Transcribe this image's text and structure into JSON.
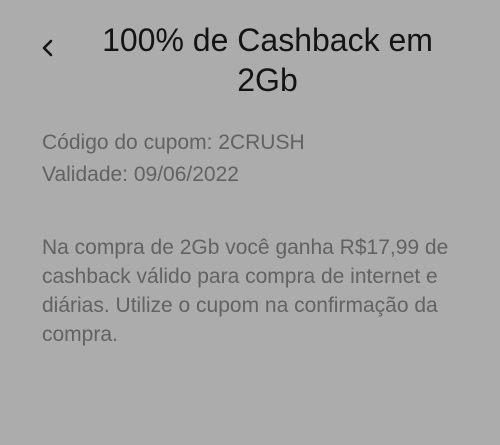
{
  "header": {
    "back_icon": "chevron-left-icon",
    "title": "100% de Cashback em 2Gb"
  },
  "coupon": {
    "code_line": "Código do cupom: 2CRUSH",
    "validity_line": "Validade: 09/06/2022"
  },
  "description": "Na compra de 2Gb você ganha R$17,99 de cashback válido para compra de internet e diárias. Utilize o cupom na confirmação da compra.",
  "colors": {
    "background": "#acacac",
    "title_text": "#141414",
    "body_text": "#626262"
  }
}
